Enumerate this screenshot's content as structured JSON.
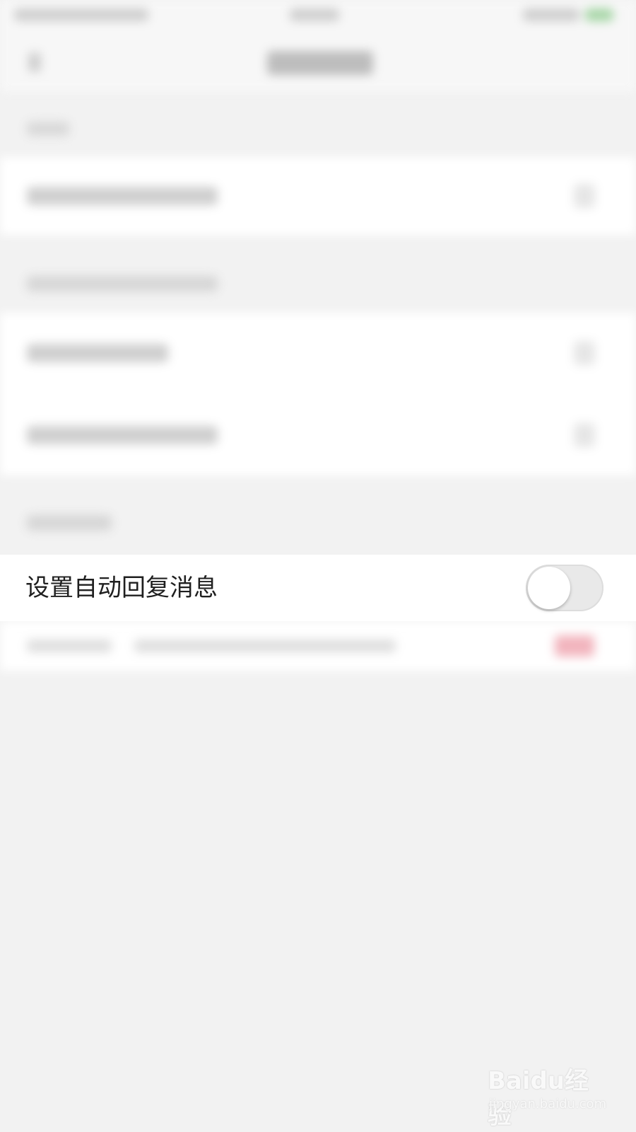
{
  "settings": {
    "auto_reply": {
      "label": "设置自动回复消息",
      "enabled": false
    }
  },
  "watermark": {
    "logo_text": "Baidu经验",
    "url_text": "jingyan.baidu.com"
  },
  "colors": {
    "background": "#f2f2f2",
    "row": "#ffffff",
    "toggle_off": "#e9e9e9",
    "accent_red": "#e8475f"
  }
}
